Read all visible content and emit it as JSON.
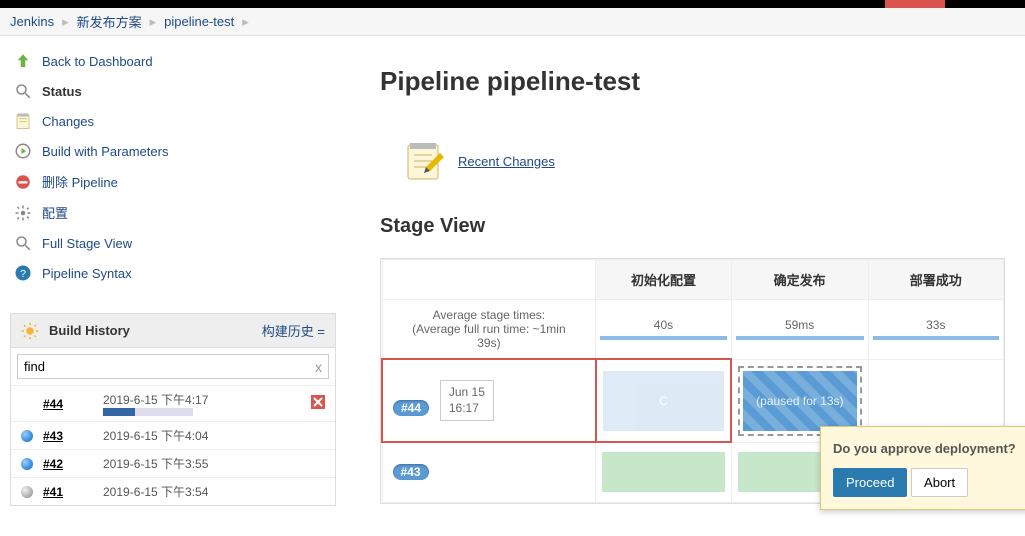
{
  "breadcrumb": {
    "root": "Jenkins",
    "folder": "新发布方案",
    "job": "pipeline-test"
  },
  "sidebar_items": [
    {
      "name": "back-to-dashboard",
      "label": "Back to Dashboard",
      "icon": "up-arrow"
    },
    {
      "name": "status",
      "label": "Status",
      "icon": "magnifier",
      "active": true
    },
    {
      "name": "changes",
      "label": "Changes",
      "icon": "notepad"
    },
    {
      "name": "build-with-parameters",
      "label": "Build with Parameters",
      "icon": "clock-play"
    },
    {
      "name": "delete-pipeline",
      "label": "删除 Pipeline",
      "icon": "no-entry"
    },
    {
      "name": "configure",
      "label": "配置",
      "icon": "gear"
    },
    {
      "name": "full-stage-view",
      "label": "Full Stage View",
      "icon": "magnifier"
    },
    {
      "name": "pipeline-syntax",
      "label": "Pipeline Syntax",
      "icon": "question"
    }
  ],
  "build_history": {
    "title": "Build History",
    "trend_link": "构建历史",
    "filter_value": "find",
    "builds": [
      {
        "num": "#44",
        "date": "2019-6-15 下午4:17",
        "running": true,
        "progress_pct": 35,
        "cancelable": true
      },
      {
        "num": "#43",
        "date": "2019-6-15 下午4:04",
        "orb": "blue"
      },
      {
        "num": "#42",
        "date": "2019-6-15 下午3:55",
        "orb": "blue"
      },
      {
        "num": "#41",
        "date": "2019-6-15 下午3:54",
        "orb": "grey"
      }
    ]
  },
  "page_title": "Pipeline pipeline-test",
  "recent_changes_label": "Recent Changes",
  "stage_view": {
    "heading": "Stage View",
    "columns": [
      "初始化配置",
      "确定发布",
      "部署成功"
    ],
    "avg_label_1": "Average stage times:",
    "avg_label_2": "(Average full run time: ~1min",
    "avg_label_3": "39s)",
    "avg_values": [
      "40s",
      "59ms",
      "33s"
    ],
    "rows": [
      {
        "badge": "#44",
        "date": "Jun 15",
        "time": "16:17",
        "paused_text": "(paused for 13s)",
        "highlighted": true
      },
      {
        "badge": "#43"
      }
    ]
  },
  "popover": {
    "message": "Do you approve deployment?",
    "proceed": "Proceed",
    "abort": "Abort"
  }
}
